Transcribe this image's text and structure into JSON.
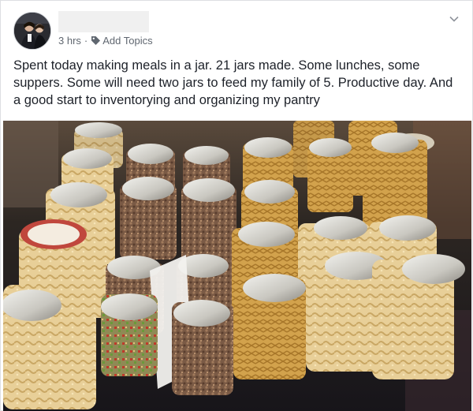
{
  "post": {
    "timestamp": "3 hrs",
    "separator": "·",
    "add_topics_label": "Add Topics",
    "body_text": "Spent today making meals in a jar. 21 jars made. Some lunches, some suppers. Some will need two jars to feed my family of 5. Productive day. And a good start to inventorying and organizing my pantry"
  },
  "icons": {
    "tag": "tag-icon",
    "menu": "chevron-down-icon"
  },
  "colors": {
    "meta_text": "#606770",
    "body_text": "#1d2129",
    "redacted_block": "#f0f0f0"
  }
}
